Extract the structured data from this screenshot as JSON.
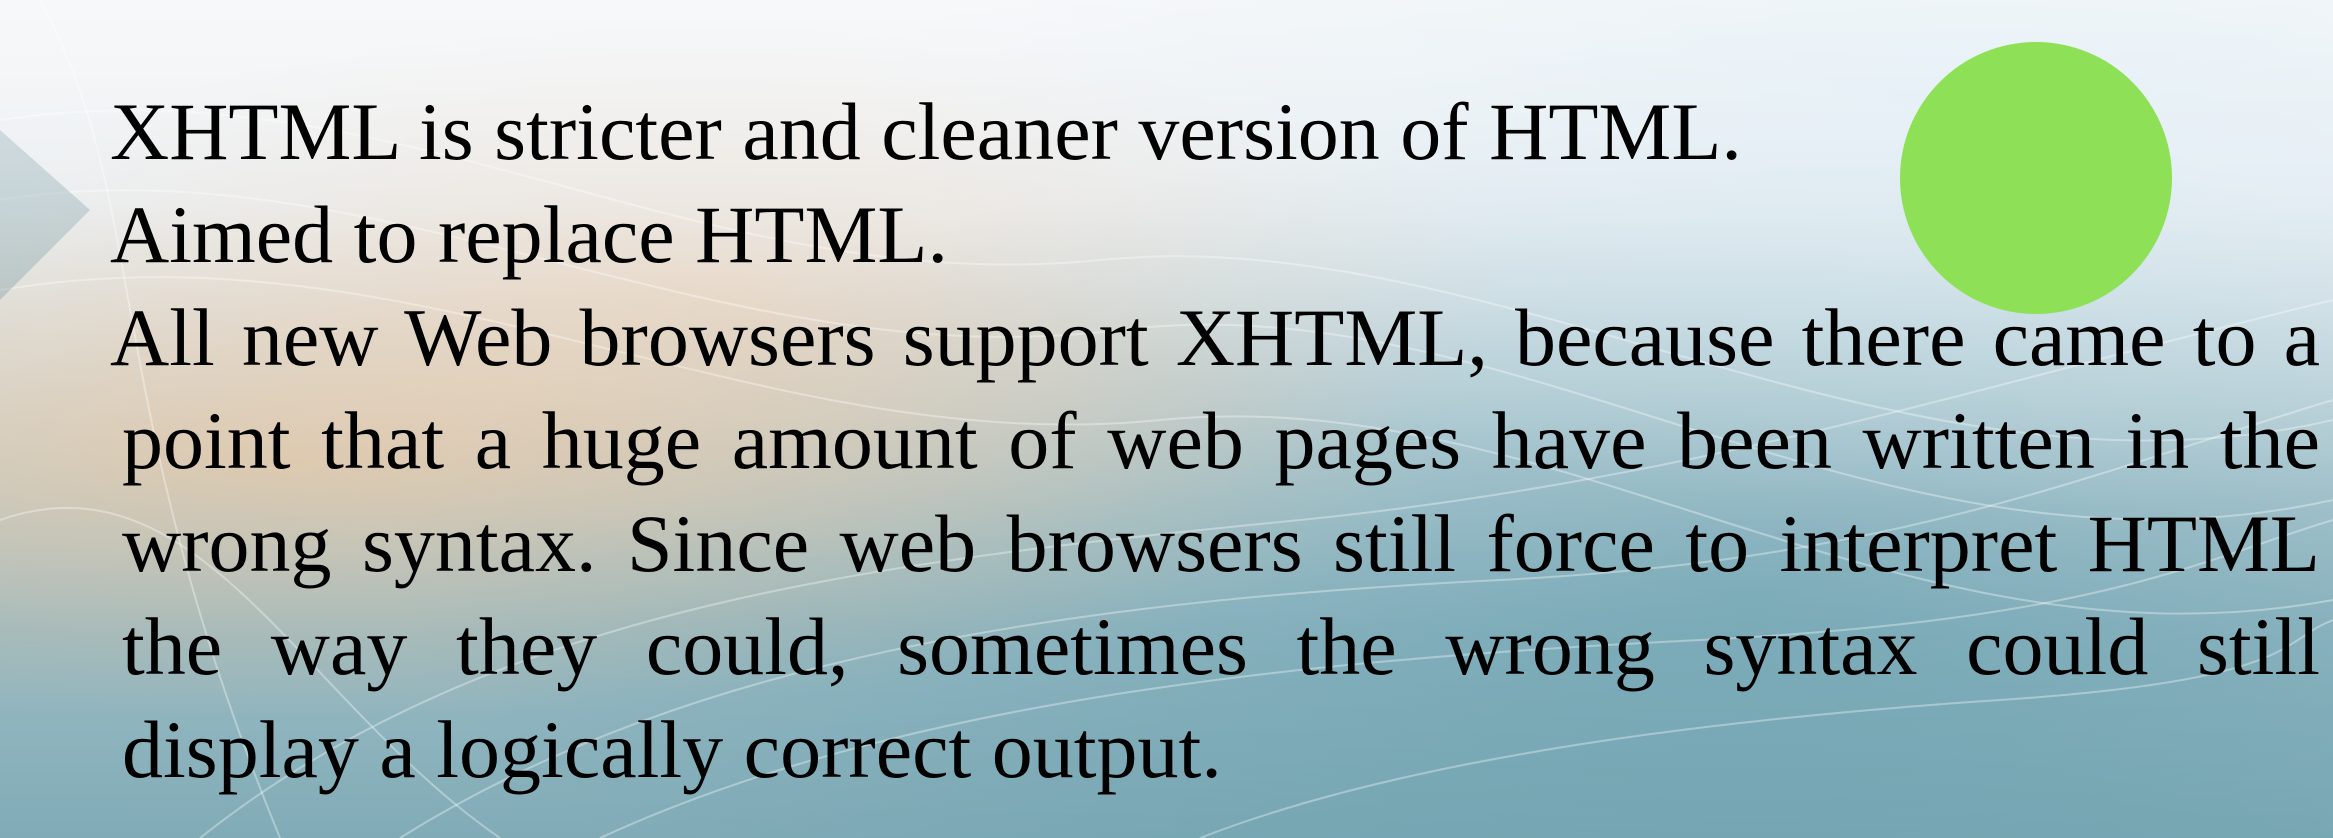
{
  "colors": {
    "circle": "#8ee056",
    "text": "#000000"
  },
  "content": {
    "bullets": [
      "XHTML is stricter and cleaner version of HTML.",
      "Aimed to replace HTML.",
      "All new Web browsers support XHTML, because there came to a point that a huge amount of web pages have been written in the wrong syntax.  Since web browsers still force to interpret HTML the way they could, sometimes the wrong syntax could still display a logically correct output."
    ]
  }
}
